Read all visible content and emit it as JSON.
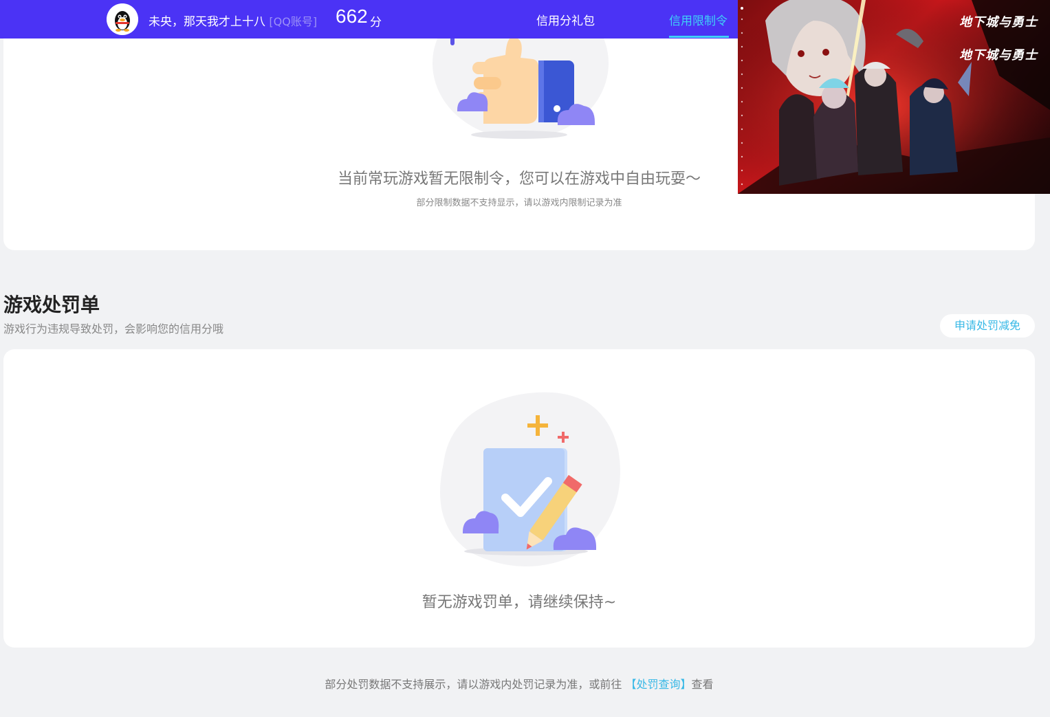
{
  "header": {
    "username": "未央，那天我才上十八",
    "account_tag": "[QQ账号]",
    "score": "662",
    "score_unit": "分",
    "nav_gift": "信用分礼包",
    "nav_limit": "信用限制令"
  },
  "banner": {
    "logo_1": "地下城与勇士",
    "logo_2": "地下城与勇士"
  },
  "limit_card": {
    "empty_main": "当前常玩游戏暂无限制令，您可以在游戏中自由玩耍～",
    "empty_sub": "部分限制数据不支持显示，请以游戏内限制记录为准"
  },
  "penalty_section": {
    "title": "游戏处罚单",
    "description": "游戏行为违规导致处罚，会影响您的信用分哦",
    "apply_button": "申请处罚减免",
    "empty_main": "暂无游戏罚单，请继续保持~"
  },
  "footer": {
    "note_prefix": "部分处罚数据不支持展示，请以游戏内处罚记录为准，或前往",
    "link": "【处罚查询】",
    "note_suffix": "查看"
  },
  "colors": {
    "header_bg": "#4b33f5",
    "active_nav": "#3fd0f6",
    "link": "#37b8e6",
    "page_bg": "#f1f2f4"
  }
}
